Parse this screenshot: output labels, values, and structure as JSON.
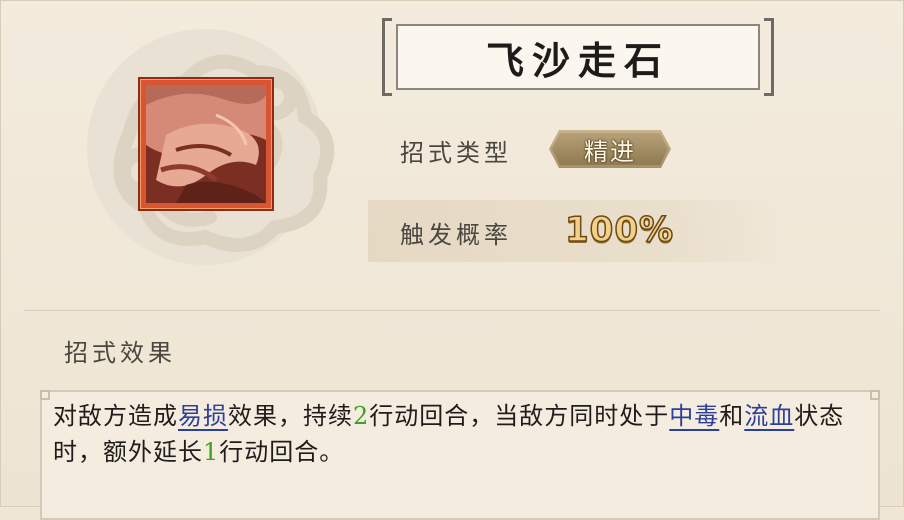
{
  "skill": {
    "name": "飞沙走石",
    "icon": "skill-flying-sand-icon",
    "type_label": "招式类型",
    "type_value": "精进",
    "trigger_label": "触发概率",
    "trigger_value": "100%"
  },
  "effect": {
    "heading": "招式效果",
    "segments": [
      {
        "text": "对敌方造成",
        "style": "plain"
      },
      {
        "text": "易损",
        "style": "keyword"
      },
      {
        "text": "效果，持续",
        "style": "plain"
      },
      {
        "text": "2",
        "style": "number"
      },
      {
        "text": "行动回合，当敌方同时处于",
        "style": "plain"
      },
      {
        "text": "中毒",
        "style": "keyword"
      },
      {
        "text": "和",
        "style": "plain"
      },
      {
        "text": "流血",
        "style": "keyword"
      },
      {
        "text": "状态时，额外延长",
        "style": "plain"
      },
      {
        "text": "1",
        "style": "number"
      },
      {
        "text": "行动回合。",
        "style": "plain"
      }
    ]
  },
  "colors": {
    "keyword": "#2c3f9a",
    "number": "#3aa02a",
    "background": "#efe6d6",
    "icon_frame": "#d9542f"
  }
}
